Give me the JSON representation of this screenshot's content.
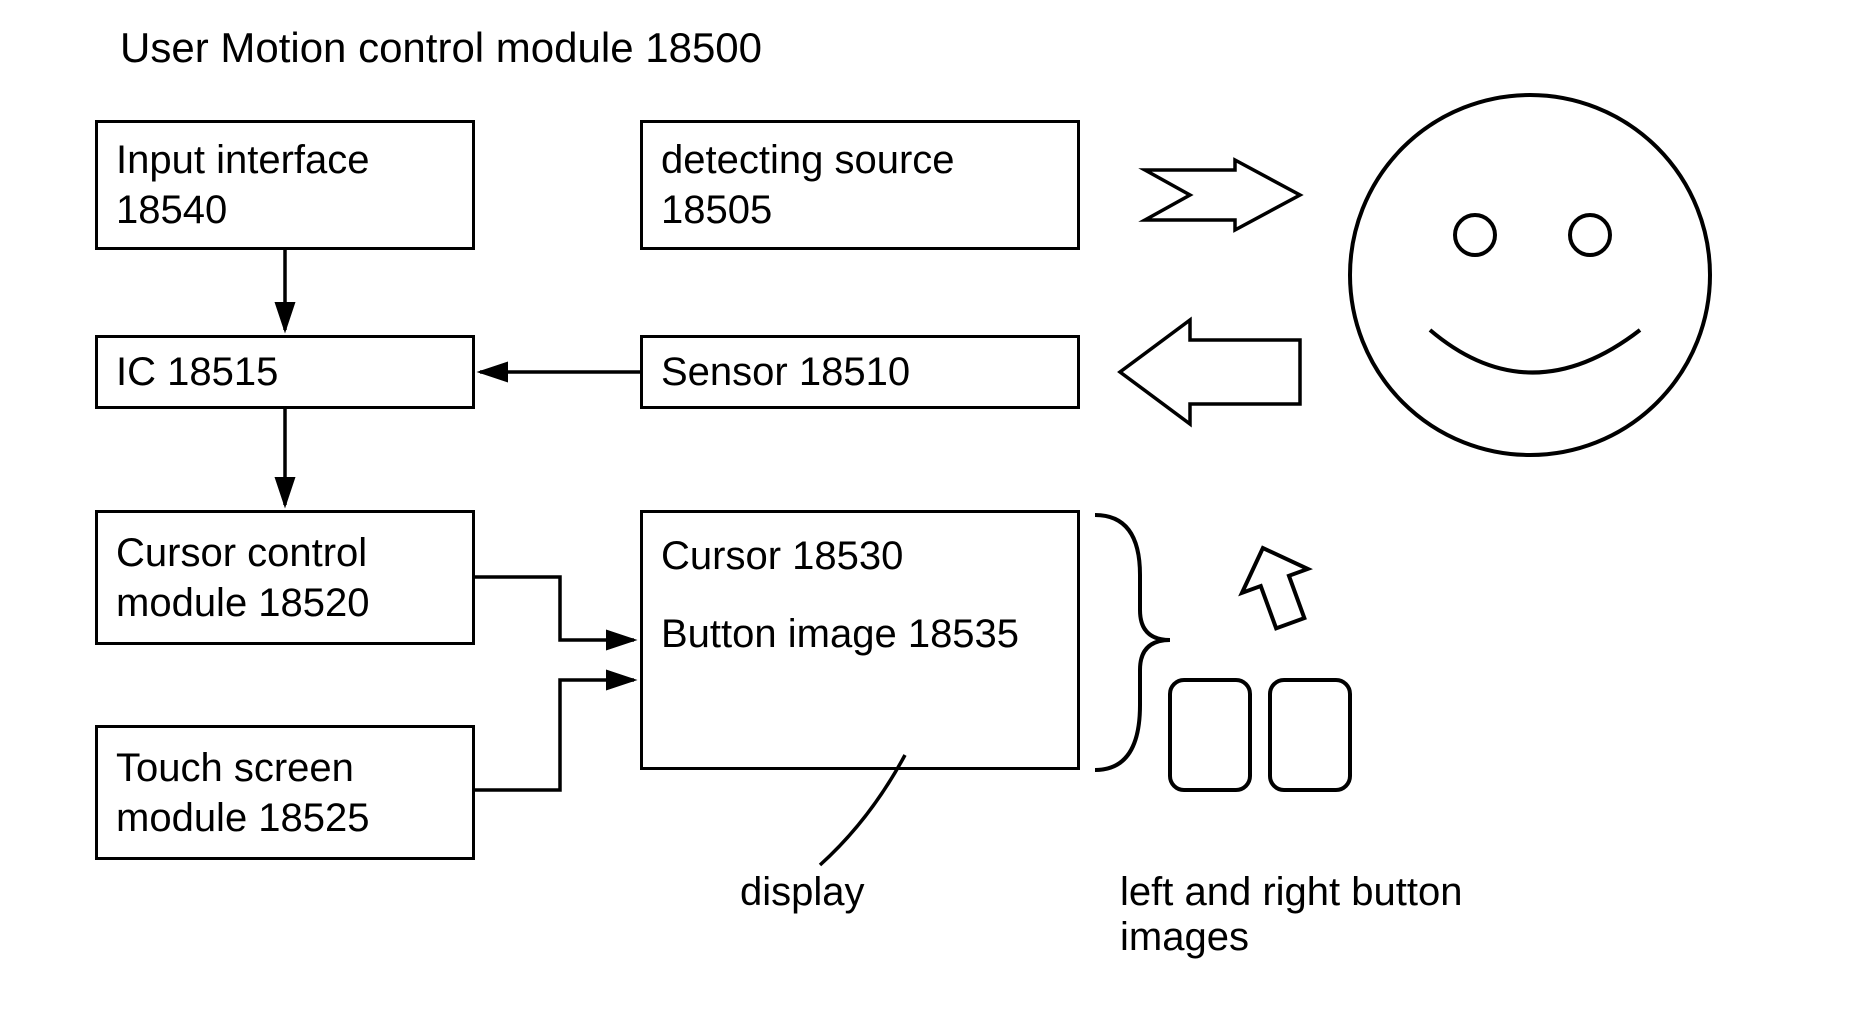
{
  "title": "User Motion control module 18500",
  "boxes": {
    "input_interface": "Input interface 18540",
    "ic": "IC   18515",
    "cursor_control_module": "Cursor control\nmodule 18520",
    "touch_screen_module": "Touch screen\nmodule 18525",
    "detecting_source": "detecting source 18505",
    "sensor": "Sensor 18510",
    "cursor_line": "Cursor 18530",
    "button_image_line": "Button image 18535"
  },
  "labels": {
    "display": "display",
    "left_right_buttons": "left and right button\nimages"
  }
}
